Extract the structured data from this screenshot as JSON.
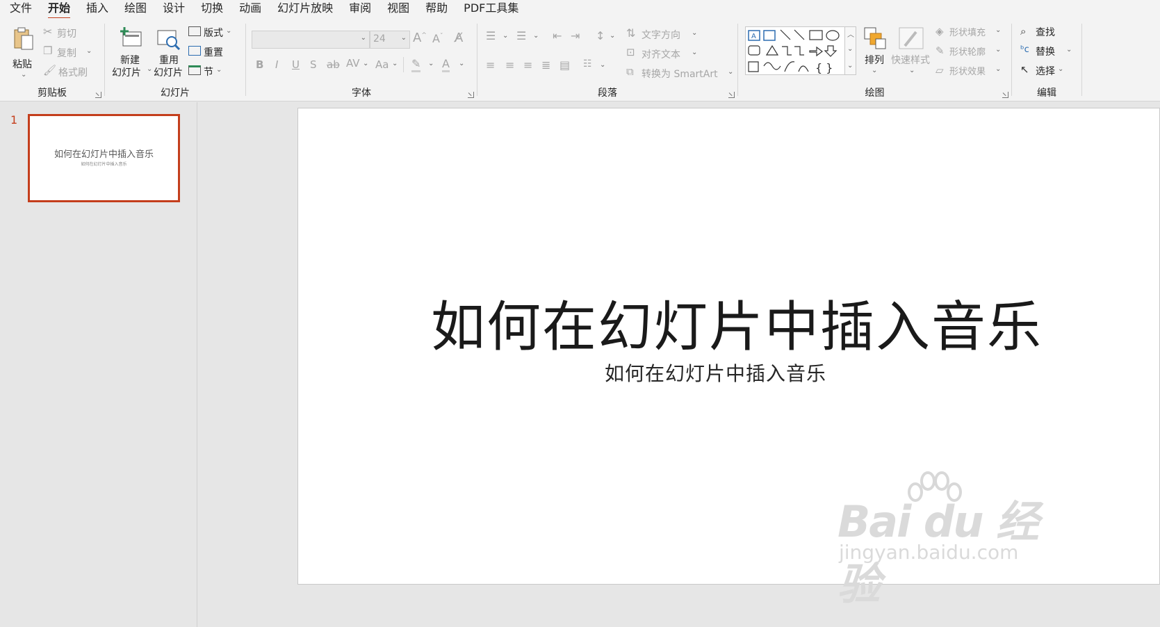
{
  "menu": [
    "文件",
    "开始",
    "插入",
    "绘图",
    "设计",
    "切换",
    "动画",
    "幻灯片放映",
    "审阅",
    "视图",
    "帮助",
    "PDF工具集"
  ],
  "active_menu_index": 1,
  "ribbon": {
    "clipboard": {
      "label": "剪贴板",
      "paste": "粘贴",
      "cut": "剪切",
      "copy": "复制",
      "format_painter": "格式刷"
    },
    "slides": {
      "label": "幻灯片",
      "new_slide_line1": "新建",
      "new_slide_line2": "幻灯片",
      "reuse_line1": "重用",
      "reuse_line2": "幻灯片",
      "layout": "版式",
      "reset": "重置",
      "section": "节"
    },
    "font": {
      "label": "字体",
      "font_name": "",
      "font_size": "24"
    },
    "paragraph": {
      "label": "段落",
      "text_direction": "文字方向",
      "align_text": "对齐文本",
      "convert_smartart": "转换为 SmartArt"
    },
    "drawing": {
      "label": "绘图",
      "arrange": "排列",
      "quick_styles": "快速样式",
      "shape_fill": "形状填充",
      "shape_outline": "形状轮廓",
      "shape_effects": "形状效果"
    },
    "editing": {
      "label": "编辑",
      "find": "查找",
      "replace": "替换",
      "select": "选择"
    }
  },
  "thumbnails": [
    {
      "number": "1",
      "title": "如何在幻灯片中插入音乐",
      "subtitle": "如何在幻灯片中插入音乐"
    }
  ],
  "slide": {
    "title": "如何在幻灯片中插入音乐",
    "subtitle": "如何在幻灯片中插入音乐"
  },
  "watermark": {
    "brand": "Bai du 经验",
    "url": "jingyan.baidu.com"
  },
  "colors": {
    "accent": "#c43e1c",
    "ribbon_bg": "#f3f3f3",
    "workspace_bg": "#e6e6e6"
  }
}
